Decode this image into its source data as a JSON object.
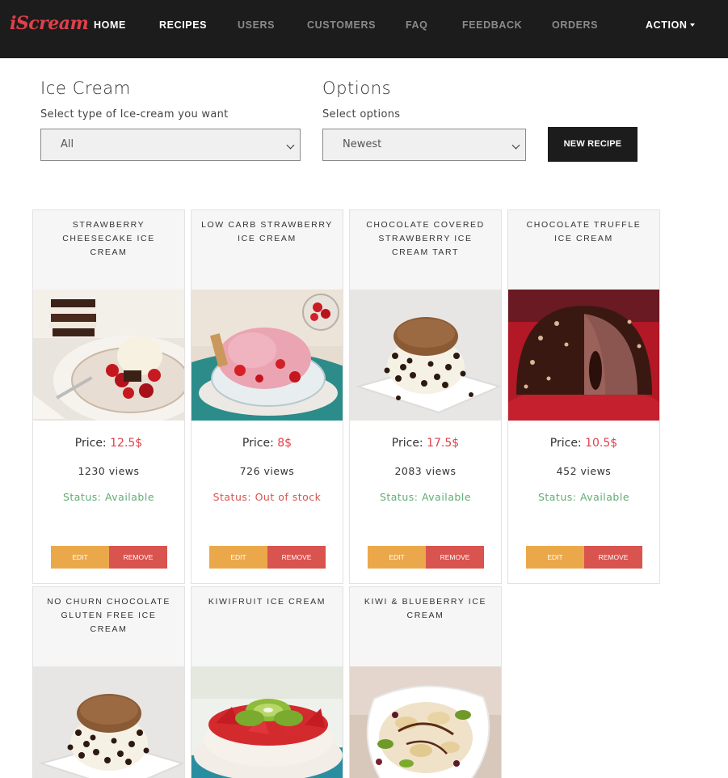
{
  "brand": "iScream",
  "nav": {
    "items": [
      {
        "label": "HOME",
        "active": true
      },
      {
        "label": "RECIPES",
        "active": true
      },
      {
        "label": "USERS",
        "active": false
      },
      {
        "label": "CUSTOMERS",
        "active": false
      },
      {
        "label": "FAQ",
        "active": false
      },
      {
        "label": "FEEDBACK",
        "active": false
      },
      {
        "label": "ORDERS",
        "active": false
      }
    ],
    "action_label": "ACTION"
  },
  "filters": {
    "icecream_title": "Ice Cream",
    "icecream_sub": "Select type of Ice-cream you want",
    "icecream_value": "All",
    "options_title": "Options",
    "options_sub": "Select options",
    "options_value": "Newest",
    "new_recipe_label": "NEW RECIPE"
  },
  "labels": {
    "price": "Price:",
    "edit": "EDIT",
    "remove": "REMOVE"
  },
  "recipes": [
    {
      "title": "STRAWBERRY CHEESECAKE ICE CREAM",
      "price": "12.5$",
      "views": "1230 views",
      "status": "Status: Available",
      "image": "strawberry-cheesecake-photo"
    },
    {
      "title": "LOW CARB STRAWBERRY ICE CREAM",
      "price": "8$",
      "views": "726 views",
      "status": "Status: Out of stock",
      "image": "strawberry-ice-cream-photo"
    },
    {
      "title": "CHOCOLATE COVERED STRAWBERRY ICE CREAM TART",
      "price": "17.5$",
      "views": "2083 views",
      "status": "Status: Available",
      "image": "chocolate-chip-sandwich-photo"
    },
    {
      "title": "CHOCOLATE TRUFFLE ICE CREAM",
      "price": "10.5$",
      "views": "452 views",
      "status": "Status: Available",
      "image": "chocolate-truffle-photo"
    },
    {
      "title": "NO CHURN CHOCOLATE GLUTEN FREE ICE CREAM",
      "image": "chocolate-chip-sandwich-photo"
    },
    {
      "title": "KIWIFRUIT ICE CREAM",
      "image": "kiwi-pavlova-photo"
    },
    {
      "title": "KIWI & BLUEBERRY ICE CREAM",
      "image": "kiwi-fruit-plate-photo"
    }
  ],
  "colors": {
    "navbar": "#1c1c1c",
    "brand": "#e0404a",
    "price": "#e0404a",
    "available": "#5fae72",
    "out_of_stock": "#d9534f",
    "edit": "#eba84a",
    "remove": "#d9534f"
  }
}
